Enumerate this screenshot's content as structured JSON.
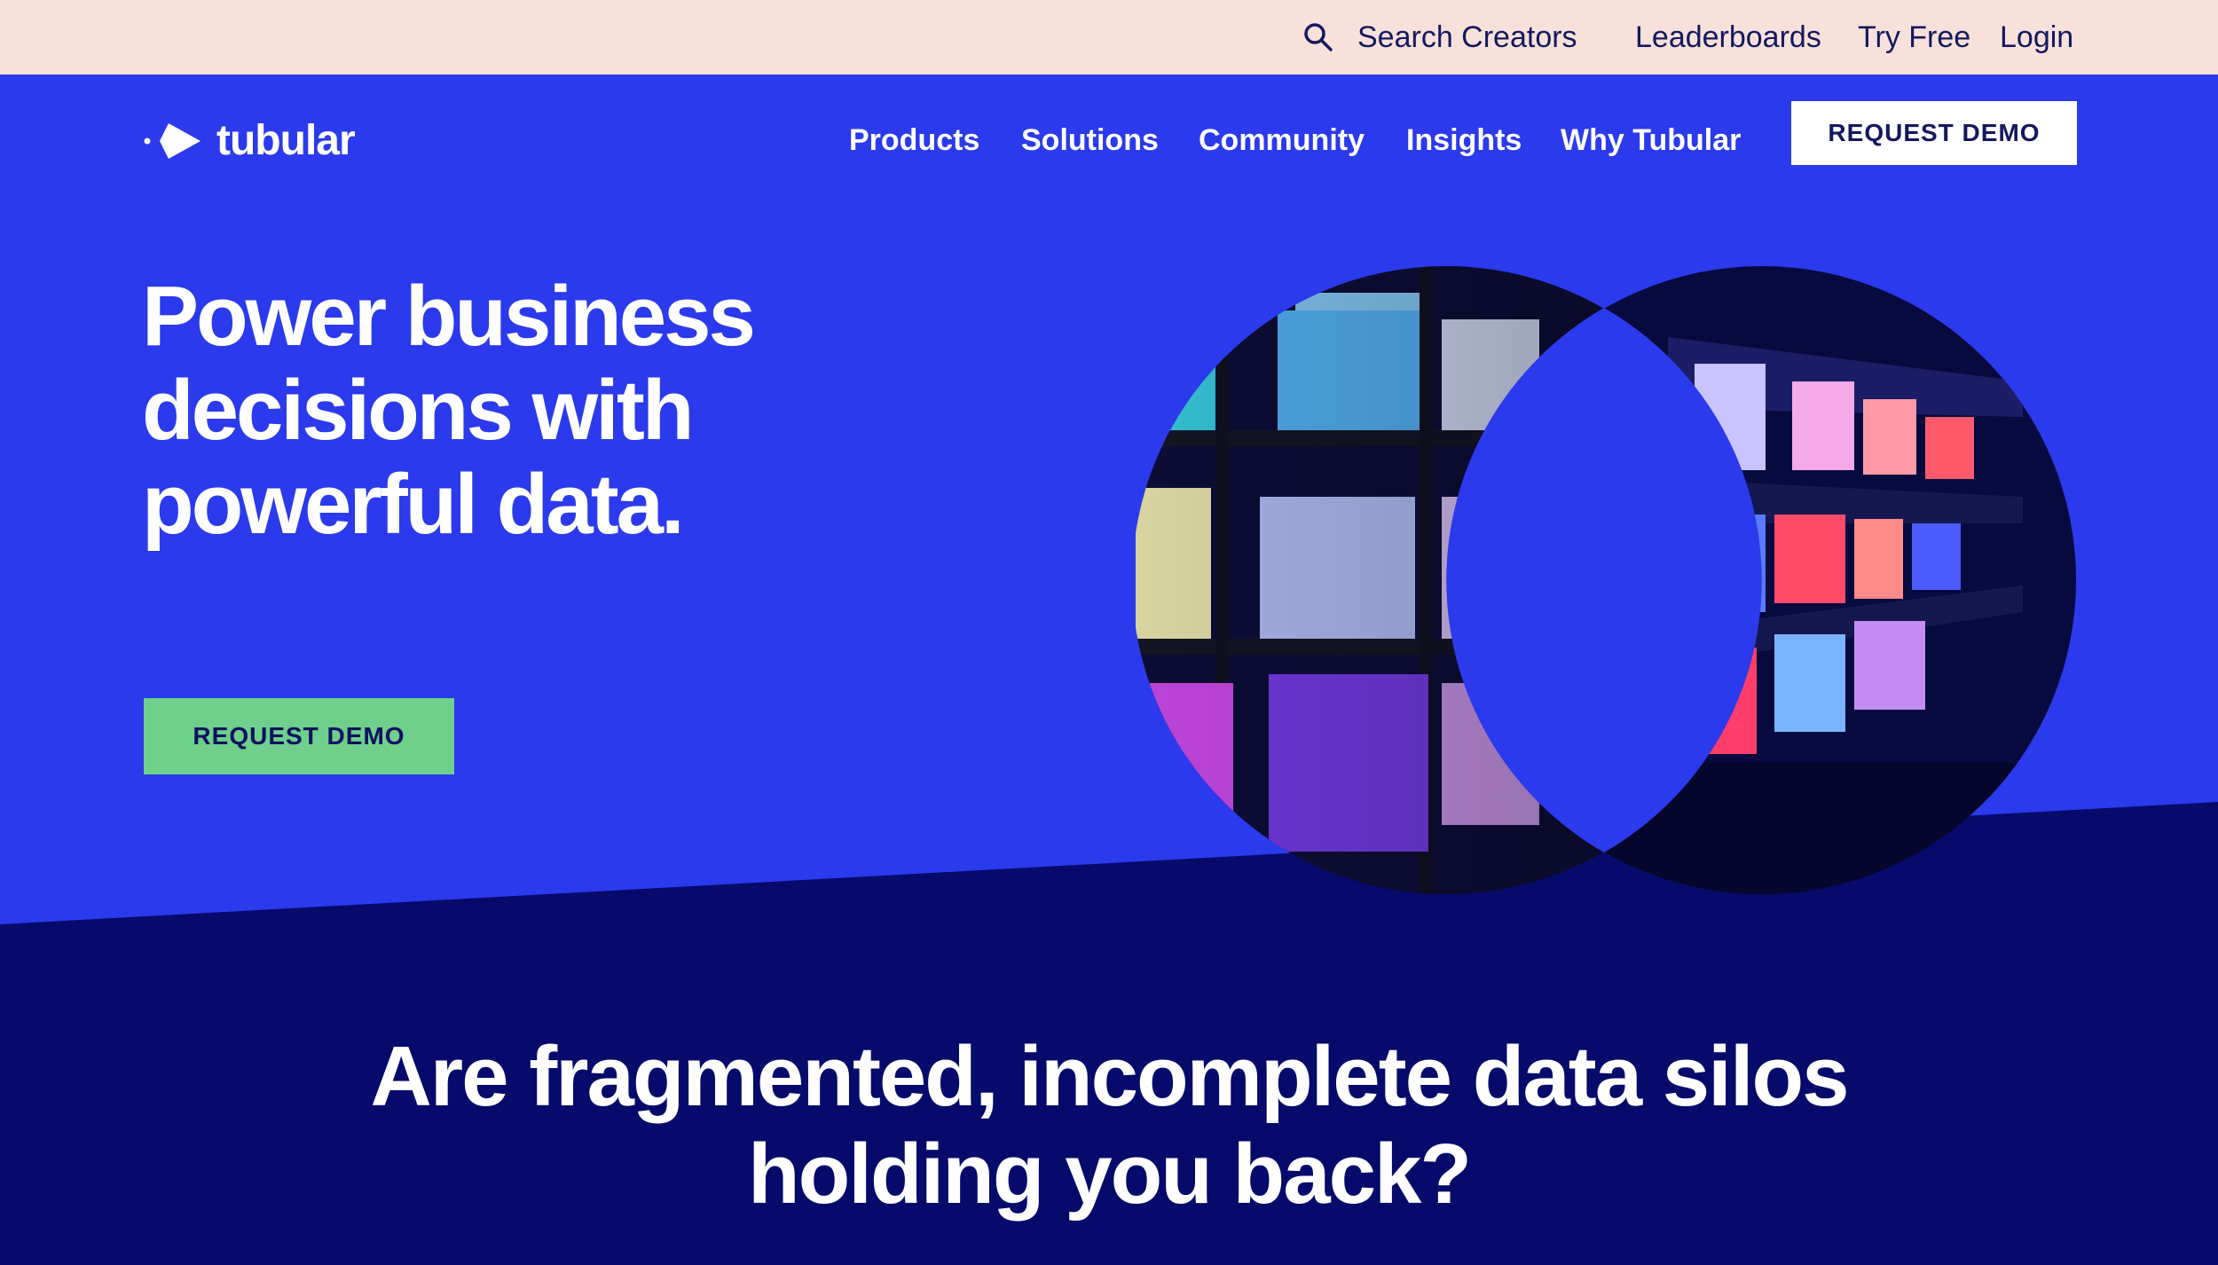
{
  "utility_bar": {
    "search_label": "Search Creators",
    "search_icon": "search-icon",
    "links": [
      "Leaderboards",
      "Try Free",
      "Login"
    ]
  },
  "header": {
    "logo_text": "tubular",
    "nav": [
      "Products",
      "Solutions",
      "Community",
      "Insights",
      "Why Tubular"
    ],
    "cta_label": "REQUEST DEMO"
  },
  "hero": {
    "headline": "Power business decisions with powerful data.",
    "cta_label": "REQUEST DEMO",
    "image": "glowing-cubes-shelf-in-overlapping-circles"
  },
  "section": {
    "headline": "Are fragmented, incomplete data silos holding you back?"
  },
  "colors": {
    "utility_bg": "#f8e1da",
    "hero_bg": "#2b3aec",
    "dark_band": "#050a6b",
    "cta_green": "#6ed08b",
    "text_dark": "#14185e",
    "white": "#ffffff"
  }
}
